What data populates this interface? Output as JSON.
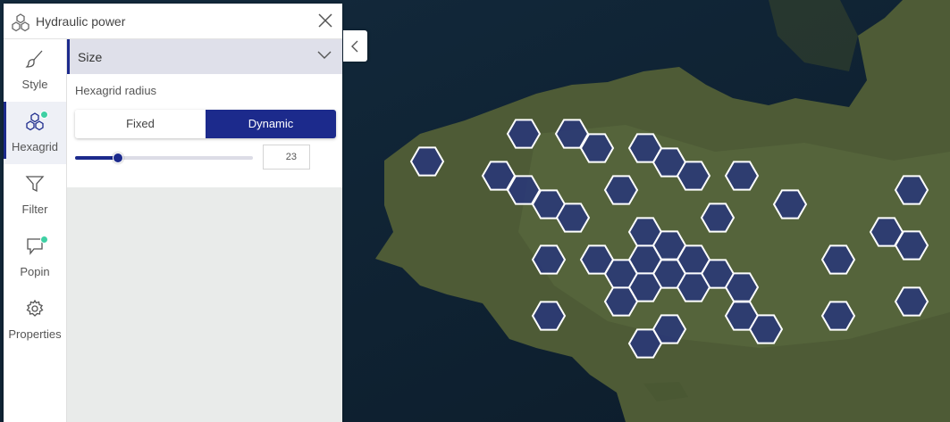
{
  "header": {
    "title": "Hydraulic power",
    "logo_icon": "hexagons-icon",
    "close_icon": "close-icon"
  },
  "sidebar": {
    "items": [
      {
        "label": "Style",
        "icon": "brush-icon",
        "active": false,
        "badge": false
      },
      {
        "label": "Hexagrid",
        "icon": "hexagrid-icon",
        "active": true,
        "badge": true
      },
      {
        "label": "Filter",
        "icon": "funnel-icon",
        "active": false,
        "badge": false
      },
      {
        "label": "Popin",
        "icon": "speech-bubble-icon",
        "active": false,
        "badge": true
      },
      {
        "label": "Properties",
        "icon": "gear-icon",
        "active": false,
        "badge": false
      }
    ]
  },
  "section": {
    "title": "Size",
    "icon": "chevron-down-icon"
  },
  "hexagrid_radius": {
    "label": "Hexagrid radius",
    "options": [
      "Fixed",
      "Dynamic"
    ],
    "selected": "Dynamic",
    "value": "23",
    "slider_fraction": 0.24
  },
  "collapse_icon": "chevron-left-icon",
  "colors": {
    "accent": "#1c2a8c",
    "badge": "#3fd0a4",
    "hex_fill": "#28367a",
    "sea": "#0e2130",
    "land": "#4c5a33"
  }
}
